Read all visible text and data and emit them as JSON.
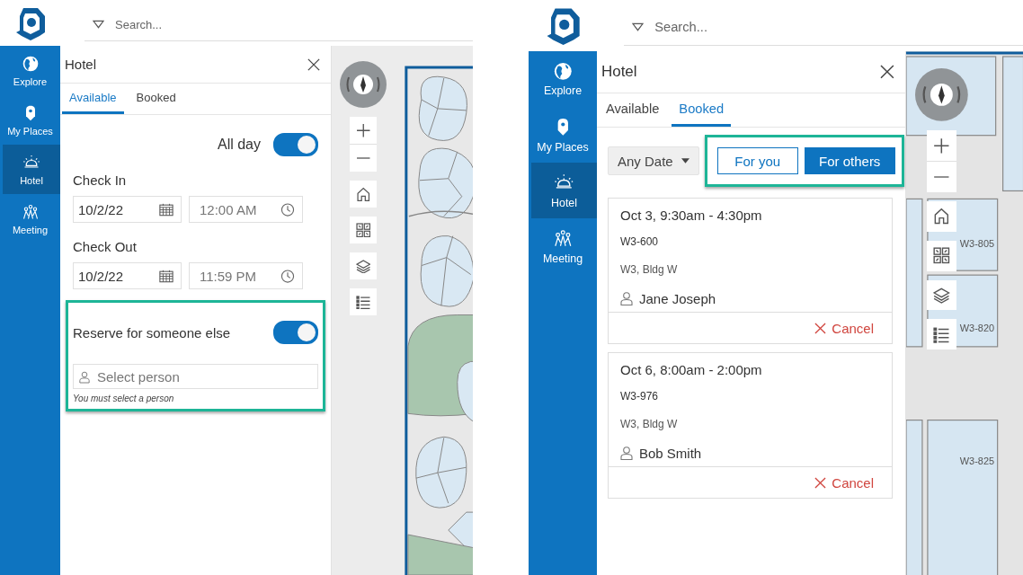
{
  "screens": [
    {
      "search": {
        "placeholder": "Search..."
      },
      "nav": [
        {
          "label": "Explore",
          "selected": false
        },
        {
          "label": "My Places",
          "selected": false
        },
        {
          "label": "Hotel",
          "selected": true
        },
        {
          "label": "Meeting",
          "selected": false
        }
      ],
      "panel": {
        "kind": "available",
        "title": "Hotel",
        "tabs": [
          {
            "label": "Available",
            "selected": true
          },
          {
            "label": "Booked",
            "selected": false
          }
        ],
        "all_day": {
          "label": "All day",
          "on": true
        },
        "check_in": {
          "label": "Check In",
          "date": "10/2/22",
          "time": "12:00 AM",
          "time_disabled": true
        },
        "check_out": {
          "label": "Check Out",
          "date": "10/2/22",
          "time": "11:59 PM",
          "time_disabled": true
        },
        "reserve": {
          "label": "Reserve for someone else",
          "on": true,
          "highlighted": true,
          "person": {
            "placeholder": "Select person"
          },
          "hint": "You must select a person"
        }
      },
      "map": {
        "kind": "pods"
      }
    },
    {
      "search": {
        "placeholder": "Search..."
      },
      "nav": [
        {
          "label": "Explore",
          "selected": false
        },
        {
          "label": "My Places",
          "selected": false
        },
        {
          "label": "Hotel",
          "selected": true
        },
        {
          "label": "Meeting",
          "selected": false
        }
      ],
      "panel": {
        "kind": "booked",
        "title": "Hotel",
        "tabs": [
          {
            "label": "Available",
            "selected": false
          },
          {
            "label": "Booked",
            "selected": true
          }
        ],
        "date_filter": {
          "label": "Any Date"
        },
        "filters_highlighted": true,
        "filters": [
          {
            "label": "For you",
            "selected": false
          },
          {
            "label": "For others",
            "selected": true
          }
        ],
        "bookings": [
          {
            "time": "Oct 3, 9:30am - 4:30pm",
            "room": "W3-600",
            "location": "W3, Bldg W",
            "person": "Jane Joseph",
            "action": "Cancel"
          },
          {
            "time": "Oct 6, 8:00am - 2:00pm",
            "room": "W3-976",
            "location": "W3, Bldg W",
            "person": "Bob Smith",
            "action": "Cancel"
          }
        ]
      },
      "map": {
        "kind": "rooms",
        "rooms": [
          "W3-805",
          "W3-820",
          "W3-825"
        ]
      }
    }
  ]
}
